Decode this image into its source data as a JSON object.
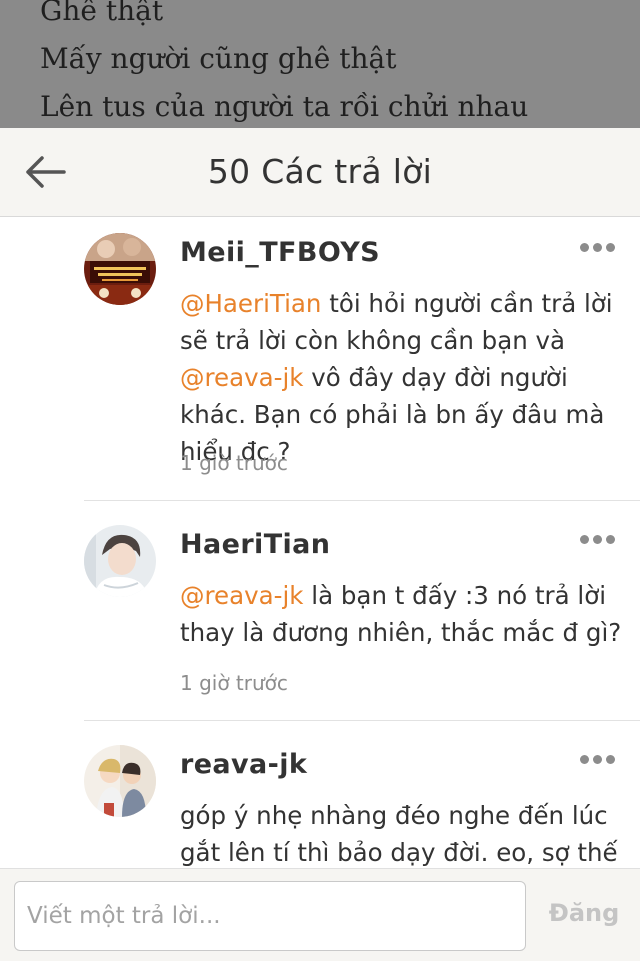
{
  "backdrop": {
    "lines": [
      "Ghê thật",
      "Mấy người cũng ghê thật",
      "Lên tus của người ta rồi chửi nhau"
    ]
  },
  "header": {
    "title": "50 Các trả lời",
    "back_icon": "arrow-left-icon"
  },
  "comments": [
    {
      "username": "Meii_TFBOYS",
      "avatar": "avatar-image",
      "body": [
        {
          "mention": "@HaeriTian"
        },
        {
          "text": " tôi hỏi người cần trả lời sẽ trả lời còn không cần bạn và "
        },
        {
          "mention": "@reava-jk"
        },
        {
          "text": " vô đây dạy đời người khác. Bạn có phải là bn ấy đâu mà hiểu đc ?"
        }
      ],
      "time": "1 giờ trước"
    },
    {
      "username": "HaeriTian",
      "avatar": "avatar-image",
      "body": [
        {
          "mention": "@reava-jk"
        },
        {
          "text": " là bạn t đấy :3 nó trả lời thay là đương nhiên, thắc mắc đ gì?"
        }
      ],
      "time": "1 giờ trước"
    },
    {
      "username": "reava-jk",
      "avatar": "avatar-image",
      "body": [
        {
          "text": "góp ý nhẹ nhàng đéo nghe đến lúc gắt lên tí thì bảo dạy đời. eo, sợ thế : ("
        }
      ],
      "time": ""
    }
  ],
  "footer": {
    "reply_placeholder": "Viết một trả lời...",
    "post_label": "Đăng"
  },
  "colors": {
    "mention": "#e8822b",
    "header_bg": "#f6f5f2",
    "backdrop": "#8a8a8a"
  }
}
